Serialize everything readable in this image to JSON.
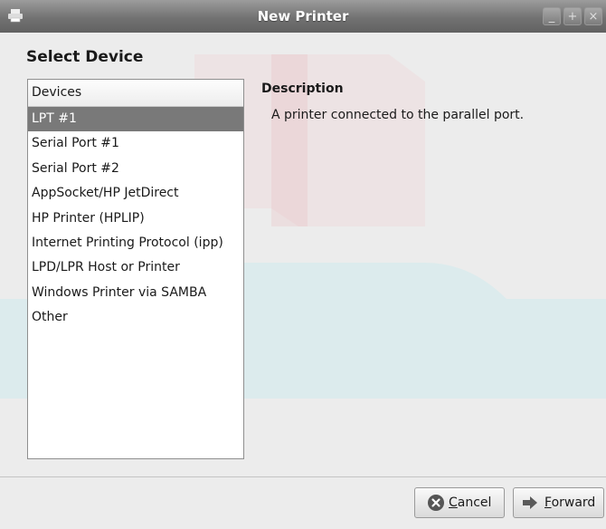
{
  "window": {
    "title": "New Printer",
    "controls": {
      "minimize": "_",
      "maximize": "+",
      "close": "×"
    }
  },
  "header": {
    "title": "Select Device"
  },
  "devices": {
    "header": "Devices",
    "selected_index": 0,
    "items": [
      "LPT #1",
      "Serial Port #1",
      "Serial Port #2",
      "AppSocket/HP JetDirect",
      "HP Printer (HPLIP)",
      "Internet Printing Protocol (ipp)",
      "LPD/LPR Host or Printer",
      "Windows Printer via SAMBA",
      "Other"
    ]
  },
  "description": {
    "title": "Description",
    "text": "A printer connected to the parallel port."
  },
  "buttons": {
    "cancel": {
      "mnemonic": "C",
      "rest": "ancel",
      "icon": "cancel-icon"
    },
    "forward": {
      "mnemonic": "F",
      "rest": "orward",
      "icon": "forward-arrow-icon"
    }
  },
  "colors": {
    "selection": "#797979",
    "titlebar": "#727272",
    "background": "#ececec"
  }
}
